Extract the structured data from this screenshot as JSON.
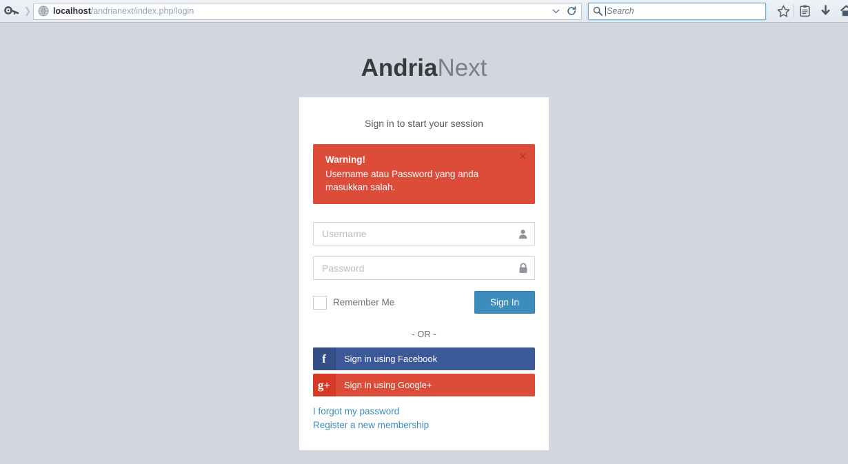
{
  "browser": {
    "key_icon": "key-icon",
    "favicon": "globe-favicon",
    "url_host": "localhost",
    "url_path": "/andrianext/index.php/login",
    "url_dropdown_icon": "chevron-down-icon",
    "reload_icon": "reload-icon",
    "search_placeholder": "Search",
    "search_value": "",
    "search_icon": "search-icon",
    "toolbar_icons": [
      {
        "name": "bookmark-star-icon"
      },
      {
        "name": "reader-list-icon"
      },
      {
        "name": "downloads-arrow-icon"
      },
      {
        "name": "home-icon"
      }
    ]
  },
  "brand": {
    "strong": "Andria",
    "light": "Next"
  },
  "login": {
    "message": "Sign in to start your session",
    "alert": {
      "title": "Warning!",
      "body": "Username atau Password yang anda masukkan salah.",
      "close_label": "×"
    },
    "username": {
      "placeholder": "Username",
      "value": "",
      "icon": "user-icon"
    },
    "password": {
      "placeholder": "Password",
      "value": "",
      "icon": "lock-icon"
    },
    "remember_label": "Remember Me",
    "remember_checked": false,
    "signin_label": "Sign In",
    "or_label": "- OR -",
    "facebook": {
      "icon_glyph": "f",
      "label": "Sign in using Facebook"
    },
    "google": {
      "icon_glyph": "g+",
      "label": "Sign in using Google+"
    },
    "forgot_link": "I forgot my password",
    "register_link": "Register a new membership"
  },
  "colors": {
    "page_bg": "#d2d6de",
    "primary": "#3c8dbc",
    "danger": "#dd4b39",
    "facebook": "#3b5998",
    "link": "#3c8dbc"
  }
}
